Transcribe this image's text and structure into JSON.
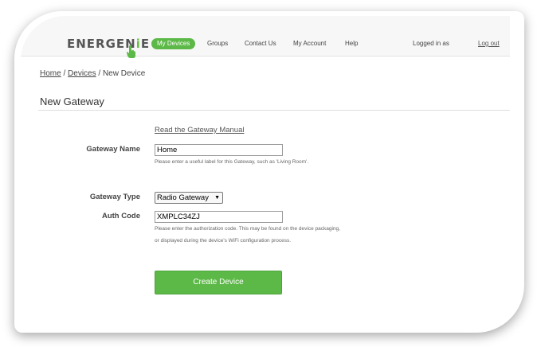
{
  "nav": {
    "logo_text": "ENERGENIE",
    "logo_letter_i": "i",
    "logo_rest": "E",
    "items": [
      "My Devices",
      "Groups",
      "Contact Us",
      "My Account",
      "Help"
    ],
    "logged_in": "Logged in as",
    "logout": "Log out"
  },
  "breadcrumb": {
    "home": "Home",
    "sep": " / ",
    "devices": "Devices",
    "current": "New Device"
  },
  "page": {
    "title": "New Gateway",
    "manual_link": "Read the Gateway Manual"
  },
  "form": {
    "name_label": "Gateway Name",
    "name_value": "Home",
    "name_help": "Please enter a useful label for this Gateway, such as 'Living Room'.",
    "type_label": "Gateway Type",
    "type_value": "Radio Gateway",
    "auth_label": "Auth Code",
    "auth_value": "XMPLC34ZJ",
    "auth_help": "Please enter the authorization code. This may be found on the device packaging, or displayed during the device's WiFi configuration process.",
    "submit_label": "Create Device"
  },
  "colors": {
    "accent": "#5cb947"
  },
  "icons": {
    "logo_cursor": "hand-pointer-icon",
    "select_arrow": "caret-down-icon"
  }
}
